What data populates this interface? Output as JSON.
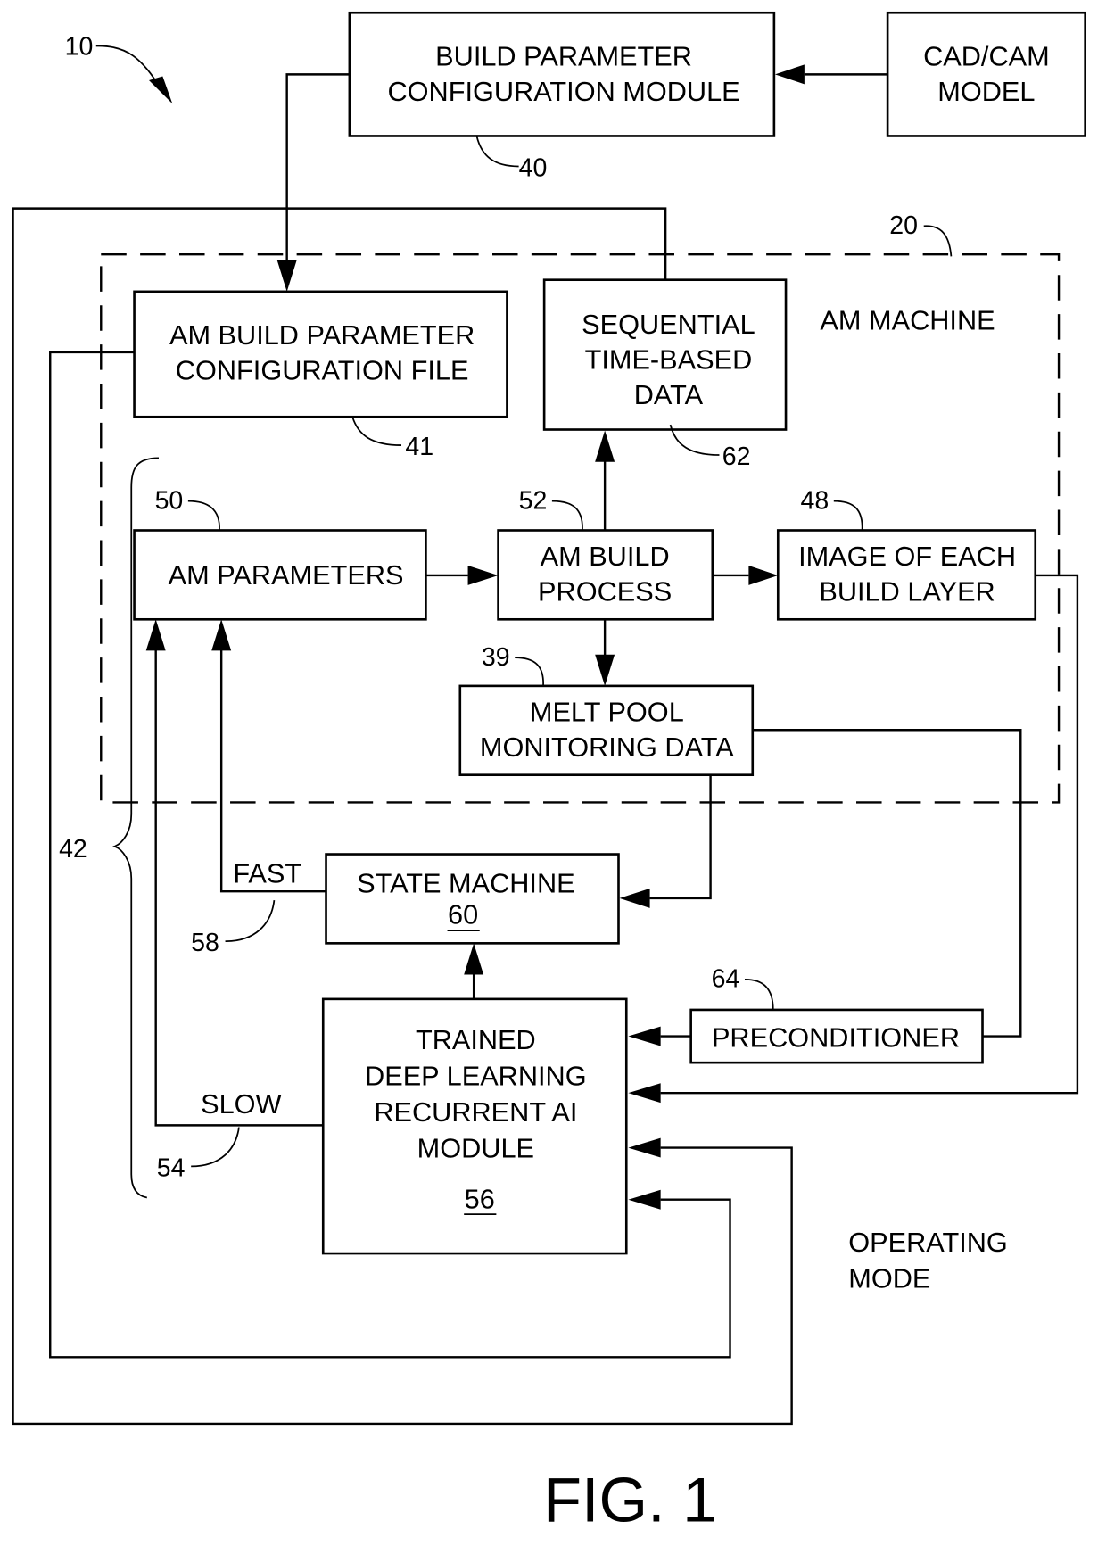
{
  "figure": {
    "caption": "FIG. 1",
    "system_ref": "10",
    "machine_ref": "20",
    "machine_label": "AM MACHINE",
    "mode_label": [
      "OPERATING",
      "MODE"
    ],
    "bracket_ref": "42"
  },
  "blocks": {
    "build_param_module": {
      "lines": [
        "BUILD PARAMETER",
        "CONFIGURATION MODULE"
      ],
      "ref": "40"
    },
    "cad_cam": {
      "lines": [
        "CAD/CAM",
        "MODEL"
      ]
    },
    "config_file": {
      "lines": [
        "AM BUILD PARAMETER",
        "CONFIGURATION FILE"
      ],
      "ref": "41"
    },
    "sequential_data": {
      "lines": [
        "SEQUENTIAL",
        "TIME-BASED",
        "DATA"
      ],
      "ref": "62"
    },
    "am_parameters": {
      "lines": [
        "AM PARAMETERS"
      ],
      "ref": "50"
    },
    "am_build_process": {
      "lines": [
        "AM BUILD",
        "PROCESS"
      ],
      "ref": "52"
    },
    "image_layer": {
      "lines": [
        "IMAGE OF EACH",
        "BUILD LAYER"
      ],
      "ref": "48"
    },
    "melt_pool": {
      "lines": [
        "MELT POOL",
        "MONITORING DATA"
      ],
      "ref": "39"
    },
    "state_machine": {
      "lines": [
        "STATE MACHINE"
      ],
      "num": "60"
    },
    "ai_module": {
      "lines": [
        "TRAINED",
        "DEEP LEARNING",
        "RECURRENT AI",
        "MODULE"
      ],
      "num": "56"
    },
    "preconditioner": {
      "lines": [
        "PRECONDITIONER"
      ],
      "ref": "64"
    }
  },
  "paths": {
    "fast": {
      "label": "FAST",
      "ref": "58"
    },
    "slow": {
      "label": "SLOW",
      "ref": "54"
    }
  }
}
